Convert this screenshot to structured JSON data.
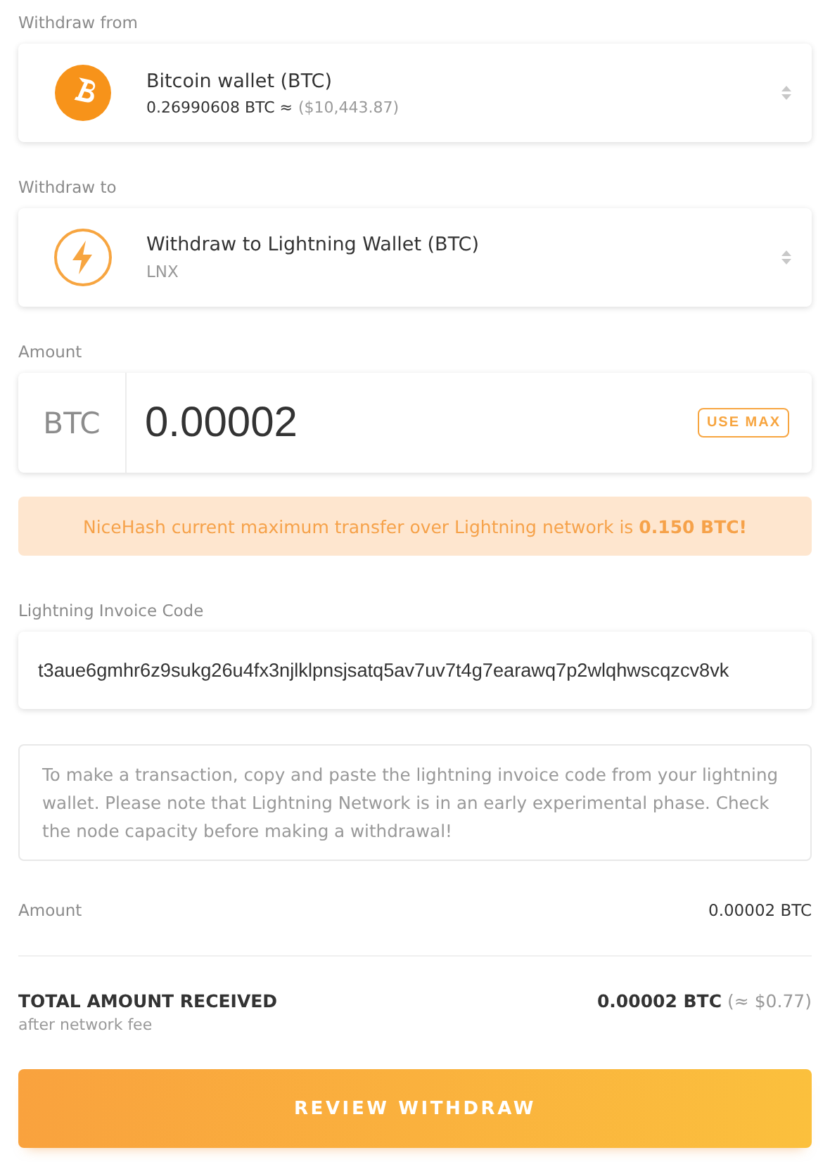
{
  "withdraw_from": {
    "label": "Withdraw from",
    "title": "Bitcoin wallet (BTC)",
    "balance": "0.26990608 BTC ≈",
    "fiat": "($10,443.87)"
  },
  "withdraw_to": {
    "label": "Withdraw to",
    "title": "Withdraw to Lightning Wallet (BTC)",
    "subtitle": "LNX"
  },
  "amount": {
    "label": "Amount",
    "currency": "BTC",
    "value": "0.00002",
    "max_button": "USE MAX"
  },
  "notice": "NiceHash current maximum transfer over Lightning network is **0.150 BTC!**",
  "invoice": {
    "label": "Lightning Invoice Code",
    "value": "t3aue6gmhr6z9sukg26u4fx3njlklpnsjsatq5av7uv7t4g7earawq7p2wlqhwscqzcv8vk"
  },
  "info": "To make a transaction, copy and paste the lightning invoice code from your lightning wallet. Please note that Lightning Network is in an early experimental phase. Check the node capacity before making a withdrawal!",
  "summary": {
    "amount_label": "Amount",
    "amount_value": "0.00002 BTC",
    "total_label": "TOTAL AMOUNT RECEIVED",
    "total_note": "after network fee",
    "total_value": "0.00002 BTC",
    "total_fiat": "(≈ $0.77)"
  },
  "submit": "REVIEW WITHDRAW"
}
